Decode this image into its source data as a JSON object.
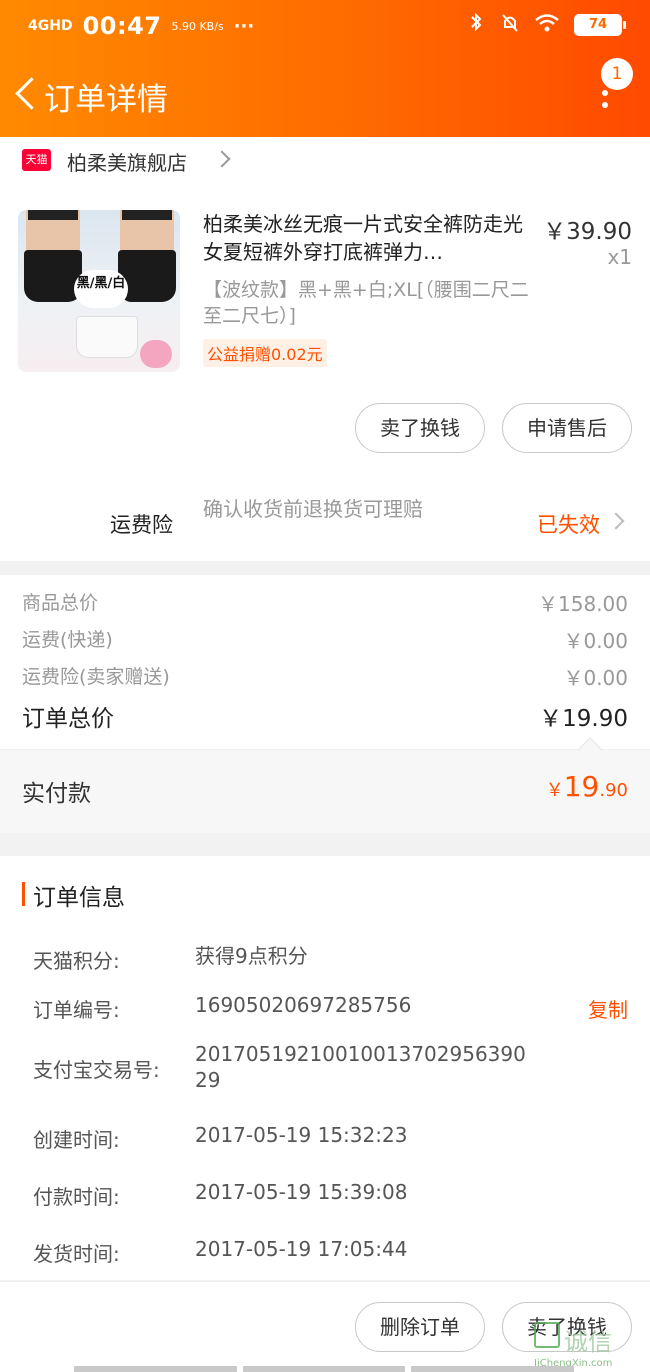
{
  "status_bar": {
    "network": "4GHD",
    "time": "00:47",
    "speed": "5.90 KB/s",
    "more": "···",
    "battery": "74"
  },
  "nav": {
    "title": "订单详情",
    "message_count": "1"
  },
  "shop": {
    "logo_text": "天猫",
    "name": "柏柔美旗舰店"
  },
  "product": {
    "title": "柏柔美冰丝无痕一片式安全裤防走光女夏短裤外穿打底裤弹力…",
    "price": "￥39.90",
    "qty": "x1",
    "sku": "【波纹款】黑+黑+白;XL[（腰围二尺二至二尺七）]",
    "charity": "公益捐赠0.02元",
    "thumb_label": "黑/黑/白"
  },
  "actions": {
    "sell_label": "卖了换钱",
    "aftersale_label": "申请售后"
  },
  "insurance": {
    "label": "运费险",
    "desc": "确认收货前退换货可理赔",
    "status": "已失效"
  },
  "totals": [
    {
      "label": "商品总价",
      "value": "￥158.00"
    },
    {
      "label": "运费(快递)",
      "value": "￥0.00"
    },
    {
      "label": "运费险(卖家赠送)",
      "value": "￥0.00"
    },
    {
      "label": "订单总价",
      "value": "￥19.90"
    }
  ],
  "paid": {
    "label": "实付款",
    "currency": "￥",
    "integer": "19",
    "decimal": ".90"
  },
  "order_info": {
    "title": "订单信息",
    "rows": [
      {
        "label": "天猫积分:",
        "value": "获得9点积分"
      },
      {
        "label": "订单编号:",
        "value": "16905020697285756",
        "action": "复制"
      },
      {
        "label": "支付宝交易号:",
        "value": "20170519210010013702956390 29"
      },
      {
        "label": "创建时间:",
        "value": "2017-05-19 15:32:23"
      },
      {
        "label": "付款时间:",
        "value": "2017-05-19 15:39:08"
      },
      {
        "label": "发货时间:",
        "value": "2017-05-19 17:05:44"
      }
    ]
  },
  "footer": {
    "delete_label": "删除订单",
    "sell_label": "卖了换钱"
  },
  "watermark": {
    "text": "诚信",
    "url": "JiChengXin.com"
  }
}
